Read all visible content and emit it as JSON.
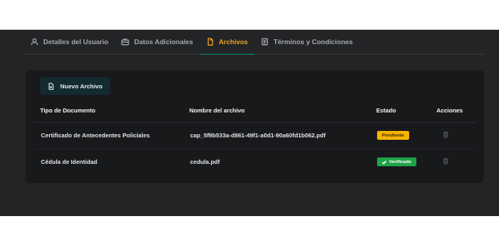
{
  "tabs": [
    {
      "label": "Detalles del Usuario",
      "icon": "user-icon",
      "active": false
    },
    {
      "label": "Datos Adicionales",
      "icon": "briefcase-icon",
      "active": false
    },
    {
      "label": "Archivos",
      "icon": "file-icon",
      "active": true
    },
    {
      "label": "Términos y Condiciones",
      "icon": "document-icon",
      "active": false
    }
  ],
  "files": {
    "new_button_label": "Nuevo Archivo",
    "columns": {
      "type": "Tipo de Documento",
      "name": "Nombre del archivo",
      "status": "Estado",
      "actions": "Acciones"
    },
    "rows": [
      {
        "type": "Certificado de Antecedentes Policiales",
        "name": "cap_5f9b533a-d861-49f1-a0d1-90a60fd1b062.pdf",
        "status": "Pendiente",
        "status_color": "#f5b400"
      },
      {
        "type": "Cédula de Identidad",
        "name": "cedula.pdf",
        "status": "Verificado",
        "status_color": "#1fa347"
      }
    ]
  },
  "colors": {
    "accent": "#f0a41c",
    "tab_underline": "#0f8a6a",
    "panel_bg": "#232426",
    "card_bg": "#18191b"
  }
}
